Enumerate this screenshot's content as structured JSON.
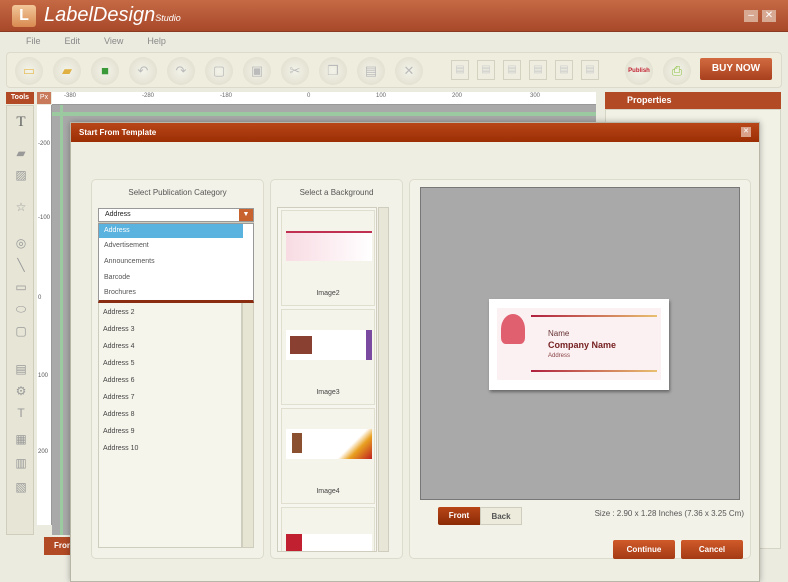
{
  "app": {
    "logo_letter": "L",
    "name": "LabelDesign",
    "name_suffix": "Studio",
    "minimize": "–",
    "close": "✕"
  },
  "menu": [
    "File",
    "Edit",
    "View",
    "Help"
  ],
  "toolbar": {
    "buy_now": "BUY NOW",
    "publish": "Publish"
  },
  "tools": {
    "header": "Tools",
    "units": "Px"
  },
  "ruler": {
    "ticks": [
      "-380",
      "-280",
      "-180",
      "0",
      "100",
      "200",
      "300"
    ],
    "vticks": [
      "-200",
      "-100",
      "0",
      "100",
      "200"
    ]
  },
  "properties": {
    "title": "Properties"
  },
  "bottom_tab": "Front",
  "dialog": {
    "title": "Start From Template",
    "category": {
      "label": "Select Publication Category",
      "selected": "Address",
      "dropdown_options": [
        "Address",
        "Advertisement",
        "Announcements",
        "Barcode",
        "Brochures"
      ],
      "items": [
        "Address 2",
        "Address 3",
        "Address 4",
        "Address 5",
        "Address 6",
        "Address 7",
        "Address 8",
        "Address 9",
        "Address 10"
      ]
    },
    "background": {
      "label": "Select a Background",
      "items": [
        "Image2",
        "Image3",
        "Image4"
      ]
    },
    "preview": {
      "name": "Name",
      "company": "Company Name",
      "address": "Address"
    },
    "front": "Front",
    "back": "Back",
    "size": "Size : 2.90 x 1.28 Inches (7.36 x 3.25 Cm)",
    "continue": "Continue",
    "cancel": "Cancel"
  },
  "colors": {
    "accent": "#a8401e",
    "title": "#b5532f"
  }
}
